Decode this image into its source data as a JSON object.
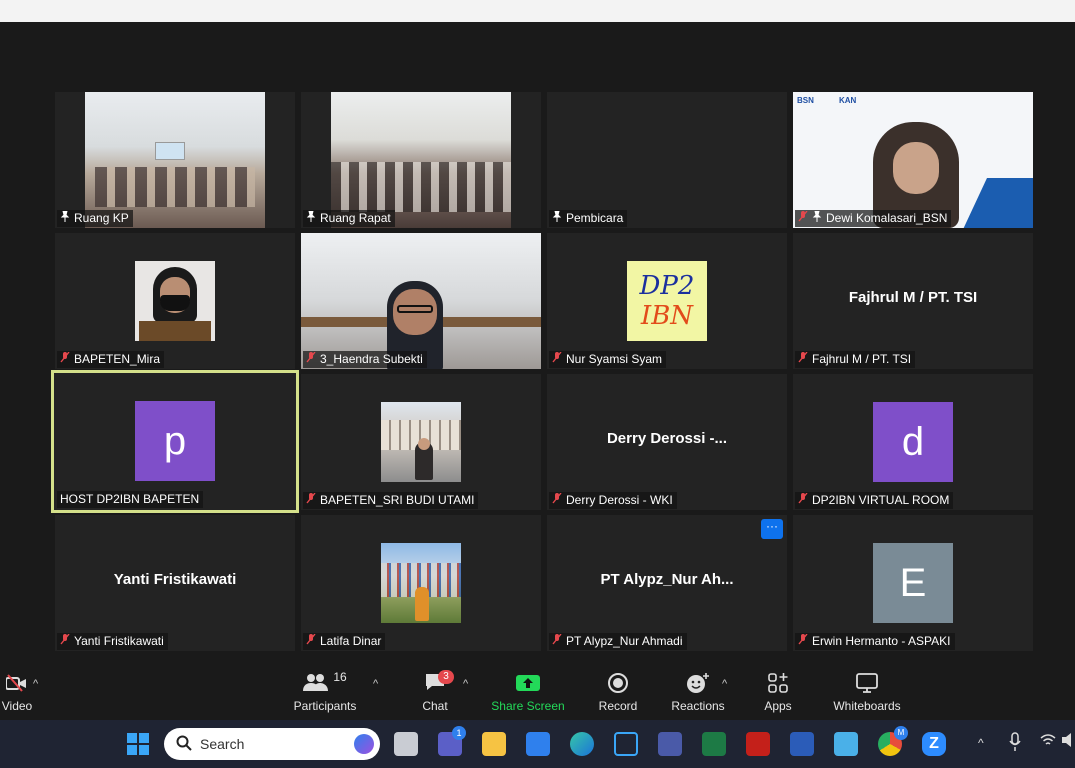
{
  "tiles": [
    {
      "name": "Ruang KP",
      "icon": "pin"
    },
    {
      "name": "Ruang Rapat",
      "icon": "pin"
    },
    {
      "name": "Pembicara",
      "icon": "pin"
    },
    {
      "name": "Dewi Komalasari_BSN",
      "icon": "muted-pin"
    },
    {
      "name": "BAPETEN_Mira",
      "icon": "muted"
    },
    {
      "name": "3_Haendra Subekti",
      "icon": "muted"
    },
    {
      "name": "Nur Syamsi Syam",
      "icon": "muted"
    },
    {
      "name": "Fajhrul M / PT. TSI",
      "display": "Fajhrul M / PT. TSI",
      "icon": "muted"
    },
    {
      "name": "HOST DP2IBN BAPETEN",
      "avatar": "p",
      "icon": "none"
    },
    {
      "name": "BAPETEN_SRI BUDI UTAMI",
      "icon": "muted"
    },
    {
      "name": "Derry Derossi - WKI",
      "display": "Derry Derossi -...",
      "icon": "muted"
    },
    {
      "name": "DP2IBN VIRTUAL ROOM",
      "avatar": "d",
      "icon": "muted"
    },
    {
      "name": "Yanti Fristikawati",
      "display": "Yanti Fristikawati",
      "icon": "muted"
    },
    {
      "name": "Latifa Dinar",
      "icon": "muted"
    },
    {
      "name": "PT Alypz_Nur Ahmadi",
      "display": "PT Alypz_Nur Ah...",
      "icon": "muted"
    },
    {
      "name": "Erwin Hermanto - ASPAKI",
      "avatar": "E",
      "icon": "muted"
    }
  ],
  "logo": {
    "line1": "DP2",
    "line2": "IBN"
  },
  "banner": {
    "left": "BSN",
    "kan": "KAN"
  },
  "colors": {
    "avatar_purple": "#7f4fc9",
    "avatar_gray": "#7a8b96",
    "active_border": "#d4e08a",
    "share_green": "#23d959"
  },
  "toolbar": {
    "video": "Video",
    "participants": "Participants",
    "participants_count": "16",
    "chat": "Chat",
    "chat_badge": "3",
    "share": "Share Screen",
    "record": "Record",
    "reactions": "Reactions",
    "apps": "Apps",
    "whiteboards": "Whiteboards"
  },
  "taskbar": {
    "search_placeholder": "Search",
    "teams_badge": "1",
    "chrome_badge": "M"
  }
}
